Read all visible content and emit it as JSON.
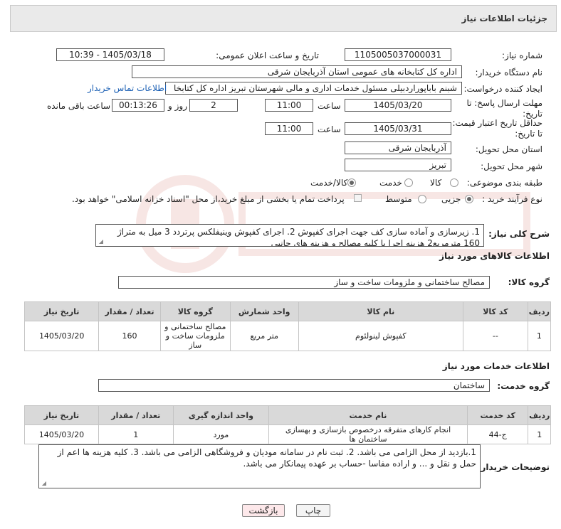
{
  "header": {
    "title": "جزئیات اطلاعات نیاز"
  },
  "fields": {
    "need_number_label": "شماره نیاز:",
    "need_number": "1105005037000031",
    "announce_label": "تاریخ و ساعت اعلان عمومی:",
    "announce_value": "1405/03/18 - 10:39",
    "buyer_org_label": "نام دستگاه خریدار:",
    "buyer_org": "اداره کل کتابخانه های عمومی استان آذربایجان شرقی",
    "creator_label": "ایجاد کننده درخواست:",
    "creator": "شبنم باباپوراردبیلی مسئول خدمات اداری و مالی شهرستان تبریز اداره کل کتابخا",
    "contact_link": "اطلاعات تماس خریدار",
    "deadline_label_1": "مهلت ارسال پاسخ: تا",
    "deadline_label_2": "تاریخ:",
    "deadline_date": "1405/03/20",
    "time_label": "ساعت",
    "deadline_time": "11:00",
    "days_value": "2",
    "days_label": "روز و",
    "remaining_value": "00:13:26",
    "remaining_label": "ساعت باقی مانده",
    "validity_label_1": "حداقل تاریخ اعتبار قیمت:",
    "validity_label_2": "تا تاریخ:",
    "validity_date": "1405/03/31",
    "validity_time": "11:00",
    "province_label": "استان محل تحویل:",
    "province": "آذربایجان شرقی",
    "city_label": "شهر محل تحویل:",
    "city": "تبریز",
    "category_label": "طبقه بندی موضوعی:",
    "category_options": [
      "کالا",
      "خدمت",
      "کالا/خدمت"
    ],
    "category_selected": "کالا/خدمت",
    "process_label": "نوع فرآیند خرید :",
    "process_options": [
      "جزیی",
      "متوسط"
    ],
    "process_selected": "جزیی",
    "payment_note": "پرداخت تمام یا بخشی از مبلغ خرید،از محل \"اسناد خزانه اسلامی\" خواهد بود."
  },
  "description": {
    "label": "شرح کلی نیاز:",
    "text": "1. زیرسازی و آماده سازی کف جهت اجرای کفپوش 2. اجرای کفپوش وینیفلکس پرتردد 3 میل به متراژ 160 مترمربع2 هزینه اجرا با کلیه مصالح و هزینه های جانبی"
  },
  "goods": {
    "section_title": "اطلاعات کالاهای مورد نیاز",
    "group_label": "گروه کالا:",
    "group_value": "مصالح ساختمانی و ملزومات ساخت و ساز",
    "columns": [
      "ردیف",
      "کد کالا",
      "نام کالا",
      "واحد شمارش",
      "گروه کالا",
      "تعداد / مقدار",
      "تاریخ نیاز"
    ],
    "rows": [
      [
        "1",
        "--",
        "کفپوش لینولئوم",
        "متر مربع",
        "مصالح ساختمانی و ملزومات ساخت و ساز",
        "160",
        "1405/03/20"
      ]
    ]
  },
  "services": {
    "section_title": "اطلاعات خدمات مورد نیاز",
    "group_label": "گروه خدمت:",
    "group_value": "ساختمان",
    "columns": [
      "ردیف",
      "کد خدمت",
      "نام خدمت",
      "واحد اندازه گیری",
      "تعداد / مقدار",
      "تاریخ نیاز"
    ],
    "rows": [
      [
        "1",
        "ج-44",
        "انجام کارهای متفرقه درخصوص بازسازی و بهسازی ساختمان ها",
        "مورد",
        "1",
        "1405/03/20"
      ]
    ]
  },
  "buyer_notes": {
    "label": "توضیحات خریدار:",
    "text": "1.بازدید از محل الزامی می باشد. 2. ثبت نام در سامانه مودیان و فروشگاهی الزامی می باشد. 3. کلیه هزینه ها اعم از حمل و نقل و ... و اراده مفاسا -حساب بر عهده پیمانکار می باشد."
  },
  "buttons": {
    "print": "چاپ",
    "back": "بازگشت"
  },
  "colors": {
    "link": "#1a5fb4",
    "header_bg": "#eaeaea",
    "table_header_bg": "#d9d9d9",
    "back_button_bg": "#fde8ea"
  }
}
